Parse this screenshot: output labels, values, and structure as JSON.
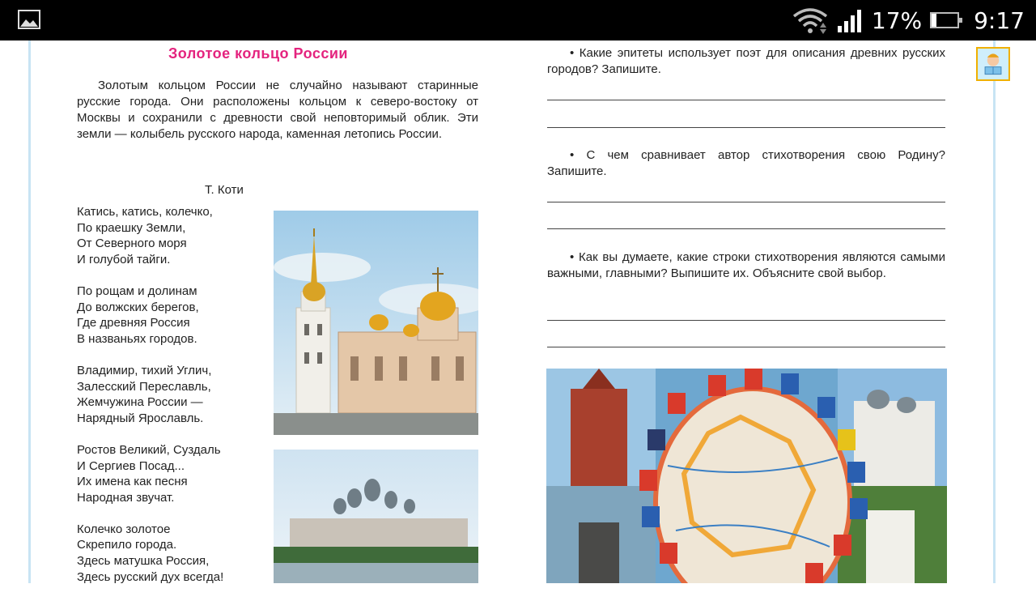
{
  "status_bar": {
    "battery_percent": "17%",
    "battery_level": 0.17,
    "time": "9:17",
    "icons": [
      "gallery-icon",
      "wifi-icon",
      "signal-icon",
      "battery-icon"
    ]
  },
  "page": {
    "title": "Золотое кольцо России",
    "intro": "Золотым кольцом России не случайно называют старинные русские города. Они расположены кольцом к северо-востоку от Москвы и сохранили с древности свой неповторимый облик. Эти земли — колыбель русского народа, каменная летопись России.",
    "author": "Т. Коти",
    "poem": [
      [
        "Катись, катись, колечко,",
        "По краешку Земли,",
        "От Северного моря",
        "И голубой тайги."
      ],
      [
        "По рощам и долинам",
        "До волжских берегов,",
        "Где древняя Россия",
        "В названьях городов."
      ],
      [
        "Владимир, тихий Углич,",
        "Залесский Переславль,",
        "Жемчужина России —",
        "Нарядный Ярославль."
      ],
      [
        "Ростов Великий, Суздаль",
        "И Сергиев Посад...",
        "Их имена как песня",
        "Народная звучат."
      ],
      [
        "Колечко золотое",
        "Скрепило города.",
        "Здесь матушка Россия,",
        "Здесь русский дух всегда!"
      ]
    ],
    "questions": [
      "• Какие эпитеты использует поэт для описания древних русских городов? Запишите.",
      "• С чем сравнивает автор стихотворения свою Родину? Запишите.",
      "• Как вы думаете, какие строки стихотворения являются самыми важными, главными? Выпишите их. Объясните свой выбор."
    ]
  },
  "colors": {
    "title": "#e4237e",
    "margin_line": "#c8e4f4",
    "status_bar": "#000000"
  }
}
